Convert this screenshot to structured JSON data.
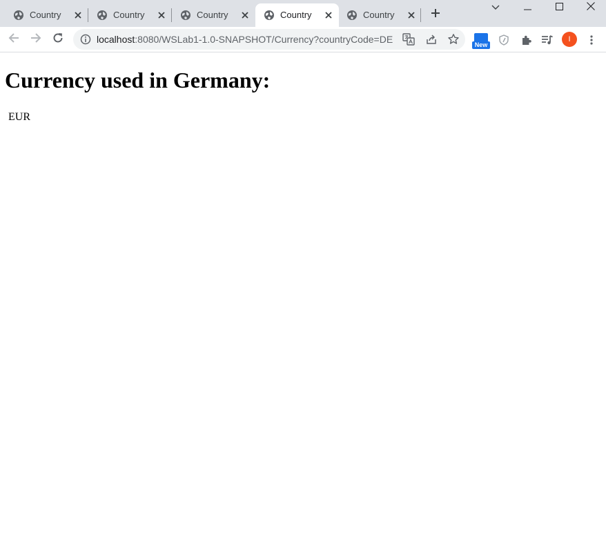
{
  "browser": {
    "tabs": [
      {
        "title": "Country",
        "active": false
      },
      {
        "title": "Country",
        "active": false
      },
      {
        "title": "Country",
        "active": false
      },
      {
        "title": "Country",
        "active": true
      },
      {
        "title": "Country",
        "active": false
      }
    ],
    "address_bar": {
      "host": "localhost",
      "path": ":8080/WSLab1-1.0-SNAPSHOT/Currency?countryCode=DE"
    },
    "extension_badge": "New",
    "profile_initial": "I",
    "icons": {
      "tab_favicon": "globe-icon",
      "accent": "#1a73e8",
      "avatar_color": "#f4511e"
    }
  },
  "page": {
    "heading": "Currency used in Germany:",
    "currency_code": "EUR"
  }
}
